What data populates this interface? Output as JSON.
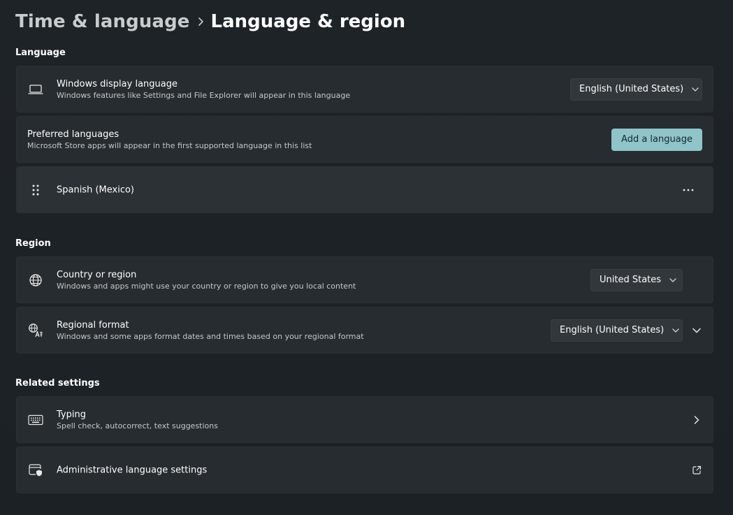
{
  "breadcrumb": {
    "parent": "Time & language",
    "current": "Language & region"
  },
  "sections": {
    "language": "Language",
    "region": "Region",
    "related": "Related settings"
  },
  "display_language": {
    "title": "Windows display language",
    "desc": "Windows features like Settings and File Explorer will appear in this language",
    "value": "English (United States)"
  },
  "preferred_languages": {
    "title": "Preferred languages",
    "desc": "Microsoft Store apps will appear in the first supported language in this list",
    "button": "Add a language"
  },
  "language_list": [
    {
      "name": "Spanish (Mexico)"
    }
  ],
  "country": {
    "title": "Country or region",
    "desc": "Windows and apps might use your country or region to give you local content",
    "value": "United States"
  },
  "regional_format": {
    "title": "Regional format",
    "desc": "Windows and some apps format dates and times based on your regional format",
    "value": "English (United States)"
  },
  "typing": {
    "title": "Typing",
    "desc": "Spell check, autocorrect, text suggestions"
  },
  "admin": {
    "title": "Administrative language settings"
  },
  "colors": {
    "accent": "#8fc5c8",
    "card": "#272c30",
    "background": "#1d2226"
  }
}
